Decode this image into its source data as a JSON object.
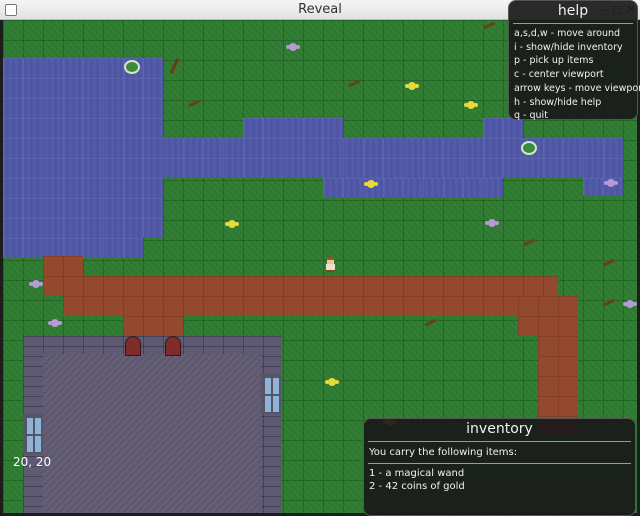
{
  "window": {
    "title": "Reveal",
    "controls": {
      "minimize": "‒",
      "maximize": "◻",
      "close": "✕"
    }
  },
  "hud": {
    "coordinates": "20, 20"
  },
  "help": {
    "title": "help",
    "lines": [
      "a,s,d,w - move around",
      "i - show/hide inventory",
      "p - pick up items",
      "c - center viewport",
      "arrow keys - move viewport",
      "h - show/hide help",
      "q - quit"
    ]
  },
  "inventory": {
    "title": "inventory",
    "intro": "You carry the following items:",
    "items": [
      "1 - a magical wand",
      "2 - 42 coins of gold"
    ]
  },
  "colors": {
    "grass": "#2d7a30",
    "water": "#4d55a4",
    "dirt": "#94492f",
    "stone": "#5f5a73",
    "panel_bg": "#191919"
  },
  "icons": [
    "player-sprite",
    "turtle-sprite",
    "wand-sprite",
    "flower-purple",
    "flower-yellow",
    "twig",
    "door",
    "window-pane"
  ]
}
